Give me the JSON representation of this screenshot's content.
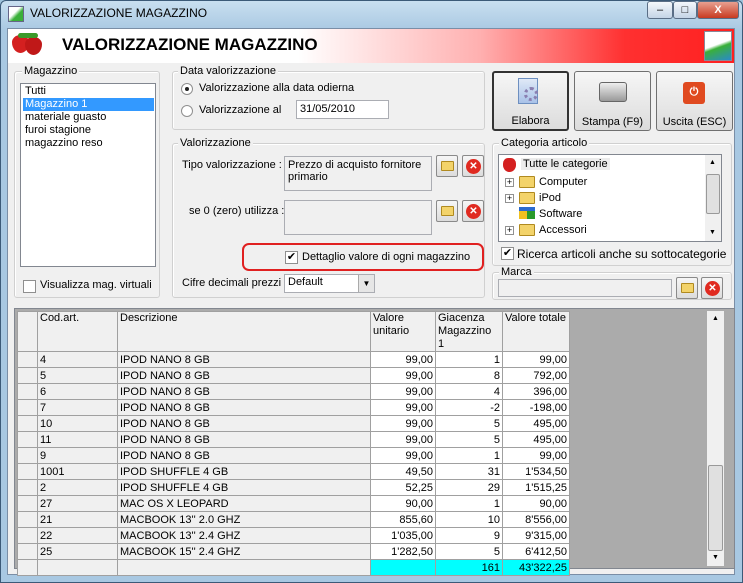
{
  "window": {
    "title": "VALORIZZAZIONE MAGAZZINO",
    "minimize": "–",
    "maximize": "□",
    "close": "X"
  },
  "banner": {
    "title": "VALORIZZAZIONE MAGAZZINO"
  },
  "magazzino": {
    "legend": "Magazzino",
    "items": [
      "Tutti",
      "Magazzino 1",
      "materiale guasto",
      "furoi stagione",
      "magazzino reso"
    ],
    "selected": "Magazzino 1",
    "virtual_label": "Visualizza mag. virtuali",
    "virtual_checked": false
  },
  "data_val": {
    "legend": "Data valorizzazione",
    "opt1": "Valorizzazione alla data odierna",
    "opt2": "Valorizzazione al",
    "date": "31/05/2010",
    "selected": "opt1"
  },
  "buttons": {
    "elabora": "Elabora",
    "stampa": "Stampa (F9)",
    "uscita": "Uscita (ESC)"
  },
  "valorizzazione": {
    "legend": "Valorizzazione",
    "tipo_label": "Tipo valorizzazione :",
    "tipo_value": "Prezzo di acquisto fornitore primario",
    "se0_label": "se 0 (zero) utilizza :",
    "se0_value": "",
    "dettaglio_label": "Dettaglio valore di ogni magazzino",
    "dettaglio_checked": true,
    "cifre_label": "Cifre decimali prezzi :",
    "cifre_value": "Default"
  },
  "categoria": {
    "legend": "Categoria articolo",
    "root": "Tutte le categorie",
    "items": [
      "Computer",
      "iPod",
      "Software",
      "Accessori"
    ],
    "sub_label": "Ricerca articoli anche su sottocategorie",
    "sub_checked": true
  },
  "marca": {
    "legend": "Marca",
    "value": ""
  },
  "grid": {
    "headers": [
      "Cod.art.",
      "Descrizione",
      "Valore unitario",
      "Giacenza Magazzino 1",
      "Valore totale"
    ],
    "rows": [
      [
        "4",
        "IPOD NANO 8 GB",
        "99,00",
        "1",
        "99,00"
      ],
      [
        "5",
        "IPOD NANO 8 GB",
        "99,00",
        "8",
        "792,00"
      ],
      [
        "6",
        "IPOD NANO 8 GB",
        "99,00",
        "4",
        "396,00"
      ],
      [
        "7",
        "IPOD NANO 8 GB",
        "99,00",
        "-2",
        "-198,00"
      ],
      [
        "10",
        "IPOD NANO 8 GB",
        "99,00",
        "5",
        "495,00"
      ],
      [
        "11",
        "IPOD NANO 8 GB",
        "99,00",
        "5",
        "495,00"
      ],
      [
        "9",
        "IPOD NANO 8 GB",
        "99,00",
        "1",
        "99,00"
      ],
      [
        "1001",
        "IPOD SHUFFLE 4 GB",
        "49,50",
        "31",
        "1'534,50"
      ],
      [
        "2",
        "IPOD SHUFFLE 4 GB",
        "52,25",
        "29",
        "1'515,25"
      ],
      [
        "27",
        "MAC OS X LEOPARD",
        "90,00",
        "1",
        "90,00"
      ],
      [
        "21",
        "MACBOOK 13'' 2.0 GHZ",
        "855,60",
        "10",
        "8'556,00"
      ],
      [
        "22",
        "MACBOOK 13'' 2.4 GHZ",
        "1'035,00",
        "9",
        "9'315,00"
      ],
      [
        "25",
        "MACBOOK 15'' 2.4 GHZ",
        "1'282,50",
        "5",
        "6'412,50"
      ]
    ],
    "totals": {
      "giacenza": "161",
      "valore": "43'322,25"
    }
  },
  "colors": {
    "total_bg": "#00ffff",
    "selection": "#3399ff",
    "highlight_border": "#e02020"
  }
}
